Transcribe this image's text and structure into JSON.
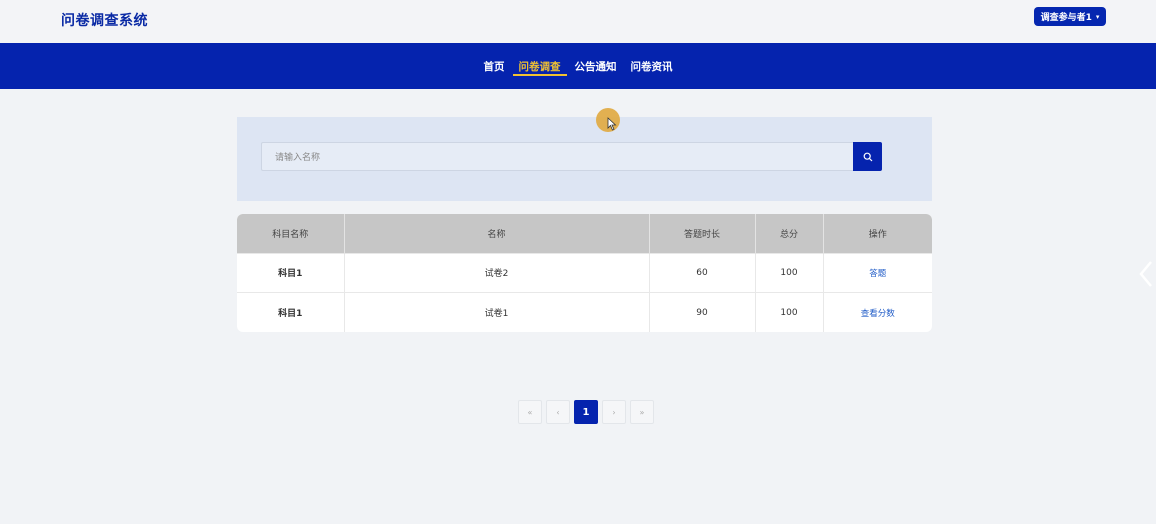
{
  "header": {
    "logo": "问卷调查系统",
    "user_label": "调查参与者1",
    "user_caret": "▾"
  },
  "nav": {
    "items": [
      {
        "label": "首页",
        "active": false
      },
      {
        "label": "问卷调查",
        "active": true
      },
      {
        "label": "公告通知",
        "active": false
      },
      {
        "label": "问卷资讯",
        "active": false
      }
    ]
  },
  "search": {
    "placeholder": "请输入名称",
    "button_icon": "search-icon"
  },
  "table": {
    "columns": [
      "科目名称",
      "名称",
      "答题时长",
      "总分",
      "操作"
    ],
    "rows": [
      {
        "subject": "科目1",
        "name": "试卷2",
        "duration": "60",
        "total": "100",
        "action": "答题"
      },
      {
        "subject": "科目1",
        "name": "试卷1",
        "duration": "90",
        "total": "100",
        "action": "查看分数"
      }
    ]
  },
  "pagination": {
    "first": "«",
    "prev": "‹",
    "current": "1",
    "next": "›",
    "last": "»"
  },
  "colors": {
    "brand": "#0523ae",
    "accent": "#f1c232",
    "link": "#1f5bc7"
  }
}
